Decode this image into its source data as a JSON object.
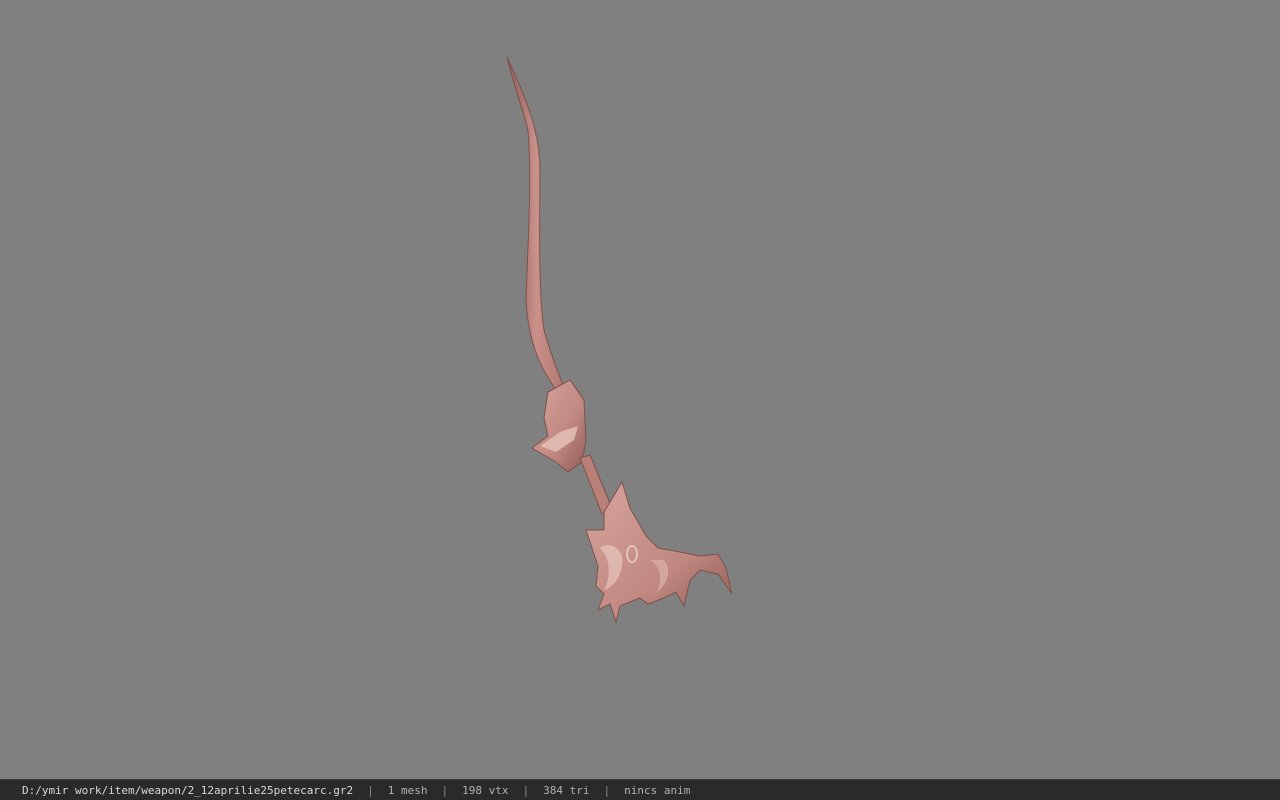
{
  "viewer": {
    "background_color": "#808080",
    "model": {
      "icon": "weapon-model",
      "color": "#c9918a",
      "highlight_color": "#e6c3ba",
      "shadow_color": "#8a5a55"
    }
  },
  "statusbar": {
    "path": "D:/ymir work/item/weapon/2_12aprilie25petecarc.gr2",
    "separator": "|",
    "mesh": "1 mesh",
    "vtx": "198 vtx",
    "tri": "384 tri",
    "anim": "nincs anim"
  }
}
